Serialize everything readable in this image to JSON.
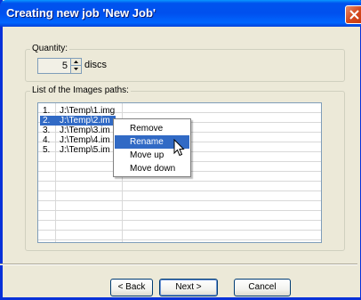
{
  "window": {
    "title": "Creating new job 'New Job'"
  },
  "quantity": {
    "legend": "Quantity:",
    "value": "5",
    "unit": "discs"
  },
  "images": {
    "legend": "List of the Images paths:",
    "rows": [
      {
        "num": "1.",
        "path": "J:\\Temp\\1.img",
        "selected": false
      },
      {
        "num": "2.",
        "path": "J:\\Temp\\2.im",
        "selected": true
      },
      {
        "num": "3.",
        "path": "J:\\Temp\\3.im",
        "selected": false
      },
      {
        "num": "4.",
        "path": "J:\\Temp\\4.im",
        "selected": false
      },
      {
        "num": "5.",
        "path": "J:\\Temp\\5.im",
        "selected": false
      }
    ]
  },
  "context_menu": {
    "items": [
      "Remove",
      "Rename",
      "Move up",
      "Move down"
    ],
    "highlighted": "Rename"
  },
  "buttons": {
    "back": "< Back",
    "next": "Next >",
    "cancel": "Cancel"
  },
  "colors": {
    "titlebar": "#0053ee",
    "selection": "#316ac5",
    "dialog_bg": "#ece9d8"
  }
}
